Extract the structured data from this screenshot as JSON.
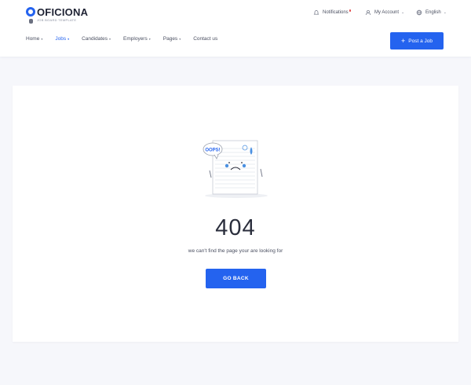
{
  "brand": {
    "name": "OFICIONA",
    "tagline": "JOB BOARD TEMPLATE",
    "accent": "#2463ef"
  },
  "topbar": {
    "notifications_label": "Notifications",
    "account_label": "My Account",
    "language_label": "English"
  },
  "nav": {
    "items": [
      {
        "label": "Home",
        "active": false
      },
      {
        "label": "Jobs",
        "active": true
      },
      {
        "label": "Candidates",
        "active": false
      },
      {
        "label": "Employers",
        "active": false
      },
      {
        "label": "Pages",
        "active": false
      },
      {
        "label": "Contact us",
        "active": false
      }
    ]
  },
  "actions": {
    "post_job_label": "Post a Job"
  },
  "error": {
    "bubble_text": "OOPS!",
    "code": "404",
    "message": "we can't find the page your are looking for",
    "back_label": "GO BACK"
  }
}
